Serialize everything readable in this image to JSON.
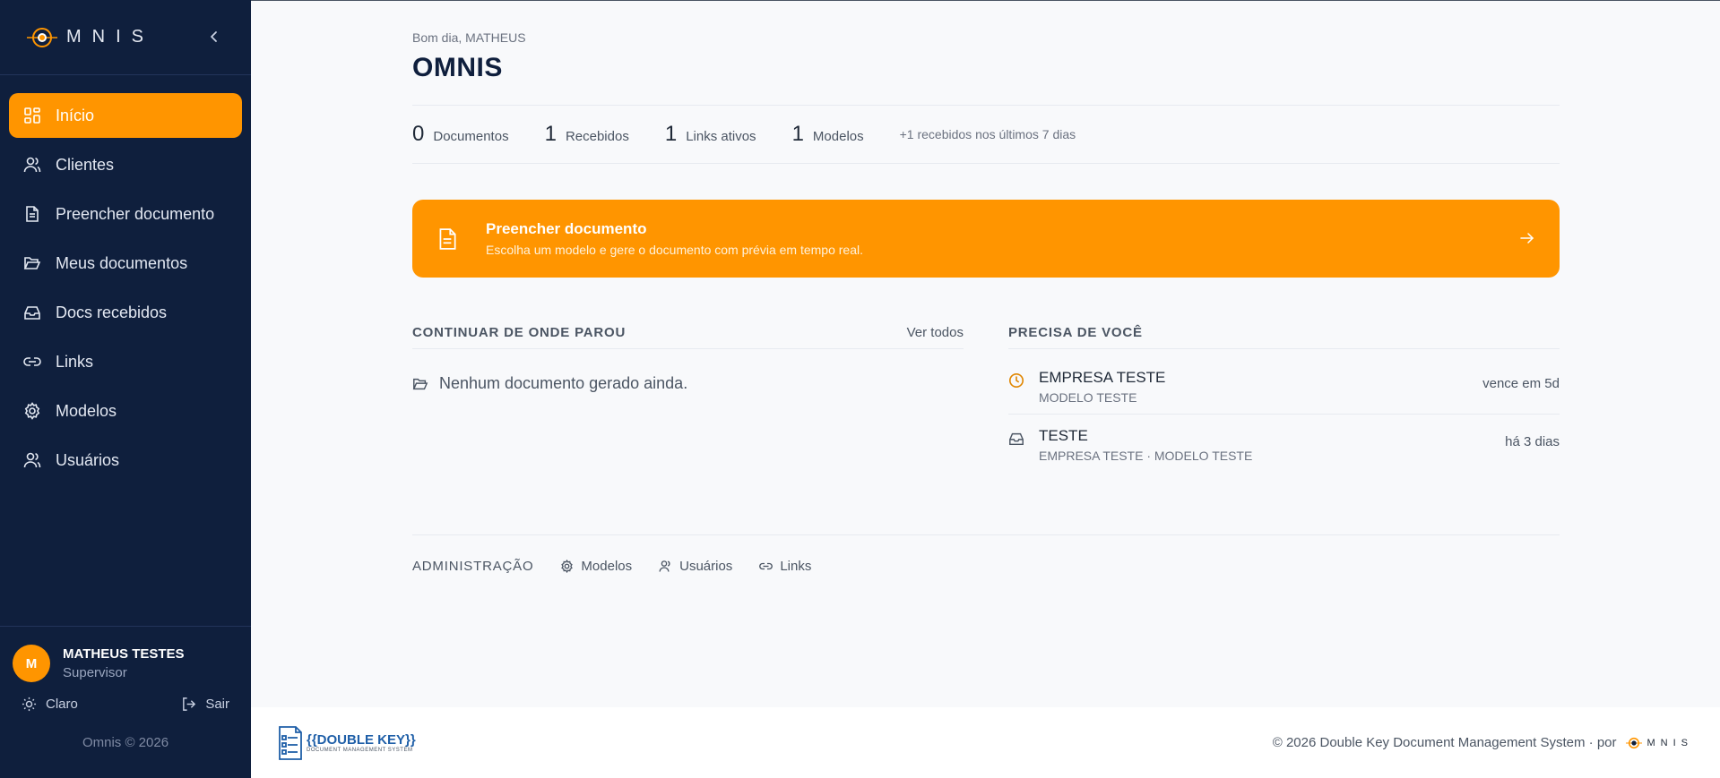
{
  "brand": {
    "name": "MNIS"
  },
  "nav": {
    "items": [
      {
        "label": "Início",
        "icon": "grid-icon",
        "active": true
      },
      {
        "label": "Clientes",
        "icon": "users-icon"
      },
      {
        "label": "Preencher documento",
        "icon": "document-icon"
      },
      {
        "label": "Meus documentos",
        "icon": "folder-open-icon"
      },
      {
        "label": "Docs recebidos",
        "icon": "inbox-icon"
      },
      {
        "label": "Links",
        "icon": "link-icon"
      },
      {
        "label": "Modelos",
        "icon": "gear-icon"
      },
      {
        "label": "Usuários",
        "icon": "users-icon"
      }
    ]
  },
  "user": {
    "initial": "M",
    "name": "MATHEUS TESTES",
    "role": "Supervisor"
  },
  "sidebar_actions": {
    "theme": "Claro",
    "logout": "Sair"
  },
  "sidebar_copyright": "Omnis © 2026",
  "header": {
    "greeting": "Bom dia, MATHEUS",
    "title": "OMNIS"
  },
  "stats": [
    {
      "value": "0",
      "label": "Documentos"
    },
    {
      "value": "1",
      "label": "Recebidos"
    },
    {
      "value": "1",
      "label": "Links ativos"
    },
    {
      "value": "1",
      "label": "Modelos"
    }
  ],
  "stats_note": "+1 recebidos nos últimos 7 dias",
  "cta": {
    "title": "Preencher documento",
    "subtitle": "Escolha um modelo e gere o documento com prévia em tempo real."
  },
  "continue": {
    "title": "CONTINUAR DE ONDE PAROU",
    "link": "Ver todos",
    "empty": "Nenhum documento gerado ainda."
  },
  "needs": {
    "title": "PRECISA DE VOCÊ",
    "items": [
      {
        "title": "EMPRESA TESTE",
        "subtitle": "MODELO TESTE",
        "meta": "vence em 5d",
        "icon": "clock-icon"
      },
      {
        "title": "TESTE",
        "subtitle": "EMPRESA TESTE · MODELO TESTE",
        "meta": "há 3 dias",
        "icon": "inbox-icon"
      }
    ]
  },
  "admin": {
    "label": "ADMINISTRAÇÃO",
    "links": [
      {
        "label": "Modelos",
        "icon": "gear-icon"
      },
      {
        "label": "Usuários",
        "icon": "users-icon"
      },
      {
        "label": "Links",
        "icon": "link-icon"
      }
    ]
  },
  "footer": {
    "logo_main": "{{DOUBLE KEY}}",
    "logo_sub": "DOCUMENT MANAGEMENT SYSTEM",
    "copyright": "© 2026 Double Key Document Management System · por",
    "brand": "MNIS"
  },
  "colors": {
    "accent": "#ff9500",
    "sidebar": "#0f1f3d",
    "background": "#f8f9fb"
  }
}
